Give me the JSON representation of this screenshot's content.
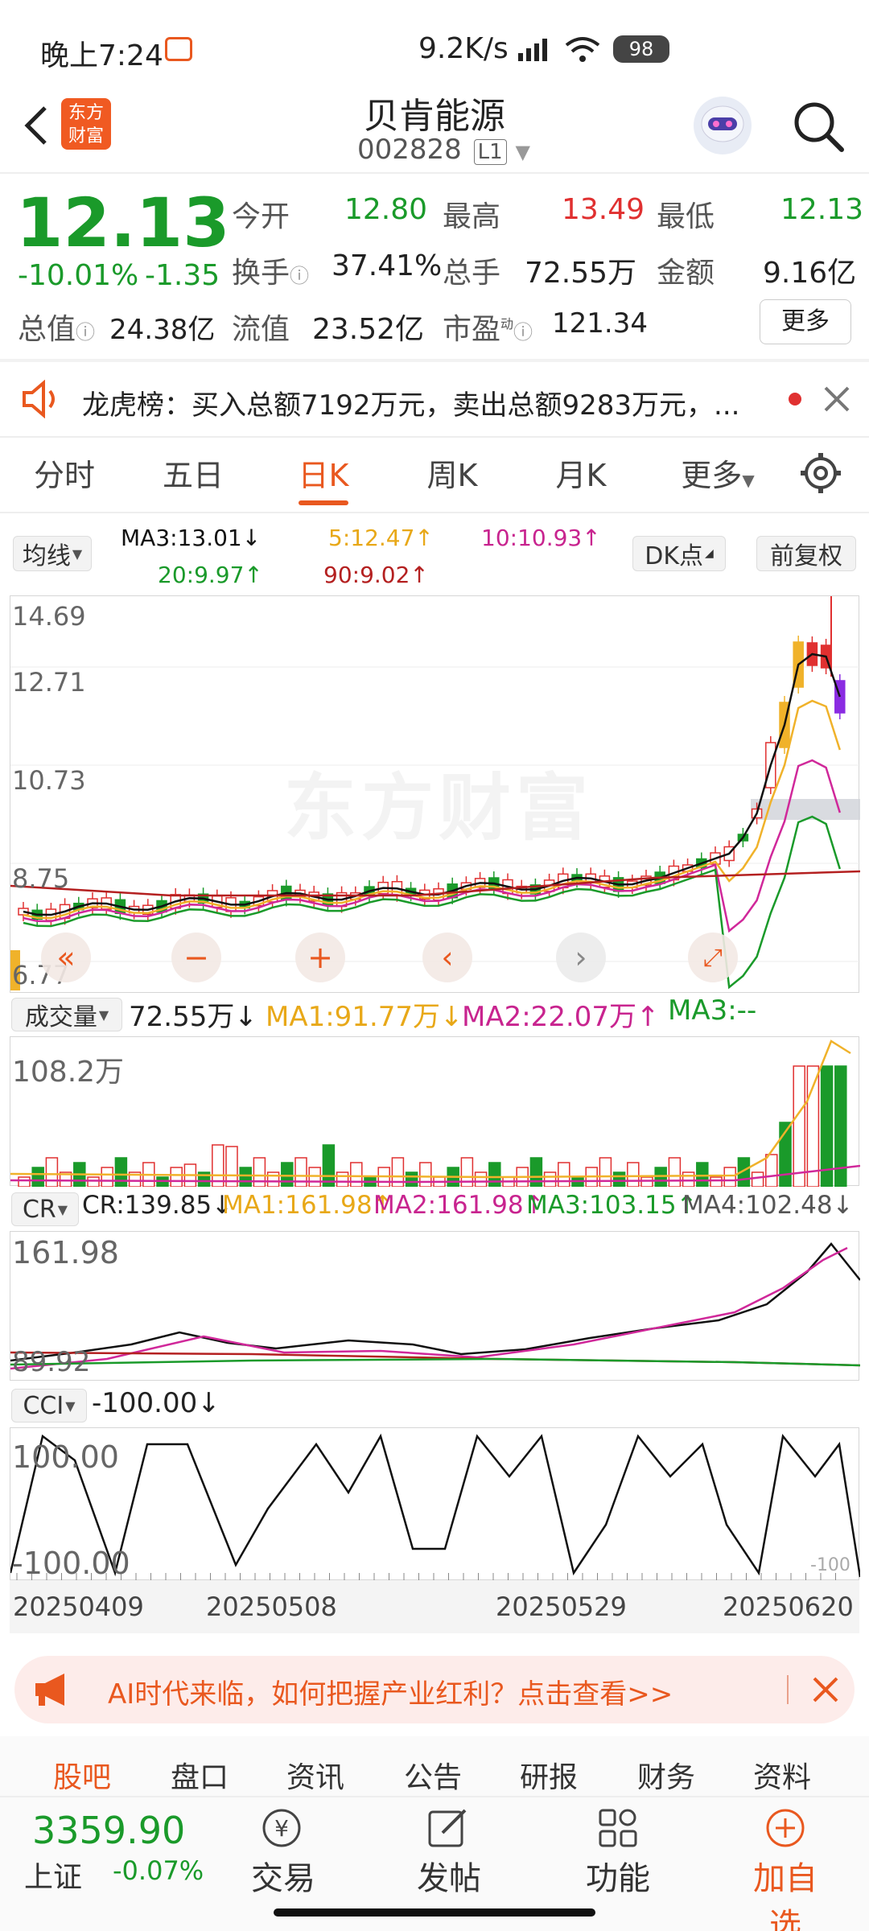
{
  "status_bar": {
    "time": "晚上7:24",
    "speed": "9.2K/s",
    "battery": "98"
  },
  "header": {
    "title": "贝肯能源",
    "code": "002828",
    "level": "L1",
    "logo_line1": "东方",
    "logo_line2": "财富"
  },
  "quote": {
    "price": "12.13",
    "change_pct": "-10.01%",
    "change": "-1.35",
    "open_label": "今开",
    "open": "12.80",
    "high_label": "最高",
    "high": "13.49",
    "low_label": "最低",
    "low": "12.13",
    "turnover_label": "换手",
    "turnover": "37.41%",
    "volume_label": "总手",
    "volume": "72.55万",
    "amount_label": "金额",
    "amount": "9.16亿",
    "total_cap_label": "总值",
    "total_cap": "24.38亿",
    "float_cap_label": "流值",
    "float_cap": "23.52亿",
    "pe_label": "市盈",
    "pe_sup": "动",
    "pe": "121.34",
    "more_button": "更多"
  },
  "notice": {
    "text": "龙虎榜：买入总额7192万元，卖出总额9283万元，..."
  },
  "tabs": [
    "分时",
    "五日",
    "日K",
    "周K",
    "月K",
    "更多"
  ],
  "active_tab": "日K",
  "ma_bar": {
    "dropdown": "均线",
    "ma3": "MA3:13.01↓",
    "ma5": "5:12.47↑",
    "ma10": "10:10.93↑",
    "ma20": "20:9.97↑",
    "ma90": "90:9.02↑",
    "dk_button": "DK点",
    "fq_button": "前复权"
  },
  "kline": {
    "y_labels": [
      "14.69",
      "12.71",
      "10.73",
      "8.75",
      "6.77"
    ],
    "watermark": "东方财富",
    "colors": {
      "ma3": "#111111",
      "ma5": "#f0b22a",
      "ma10": "#d0289a",
      "ma20": "#1a9a2a",
      "ma90": "#b42020",
      "up": "#e03030",
      "down": "#1a9a2a"
    }
  },
  "volume_panel": {
    "dropdown": "成交量",
    "value": "72.55万↓",
    "ma1": "MA1:91.77万↓",
    "ma2": "MA2:22.07万↑",
    "ma3": "MA3:--",
    "y_label": "108.2万"
  },
  "cr_panel": {
    "dropdown": "CR",
    "value": "CR:139.85↓",
    "ma1": "MA1:161.98↑",
    "ma2": "MA2:161.98↑",
    "ma3": "MA3:103.15↑",
    "ma4": "MA4:102.48↓",
    "y_top": "161.98",
    "y_bottom": "89.92"
  },
  "cci_panel": {
    "dropdown": "CCI",
    "value": "-100.00↓",
    "y_top": "100.00",
    "y_bottom": "-100.00",
    "y_right": "-100"
  },
  "x_dates": [
    "20250409",
    "20250508",
    "20250529",
    "20250620"
  ],
  "ad_banner": {
    "text": "AI时代来临，如何把握产业红利？点击查看>>"
  },
  "bottom_tabs": [
    "股吧",
    "盘口",
    "资讯",
    "公告",
    "研报",
    "财务",
    "资料"
  ],
  "toolbar": {
    "index_value": "3359.90",
    "index_name": "上证",
    "index_change": "-0.07%",
    "trade": "交易",
    "post": "发帖",
    "function": "功能",
    "add_watch": "加自选"
  }
}
